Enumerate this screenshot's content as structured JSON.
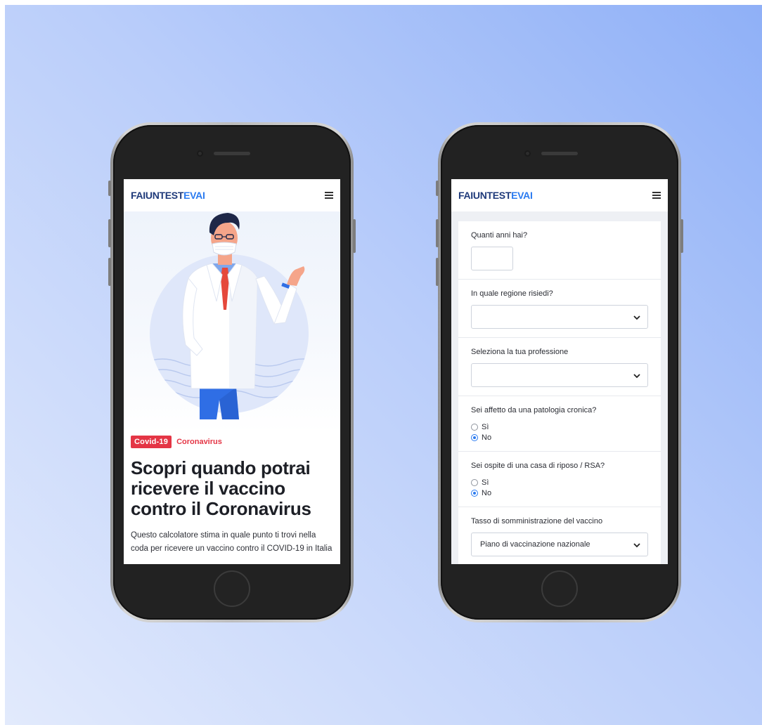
{
  "colors": {
    "background_start": "#e2eafc",
    "background_end": "#8fb0f7",
    "brand_dark": "#1f3a7a",
    "brand_blue": "#2b7bf0",
    "accent_red": "#e43545"
  },
  "logo": {
    "part_dark": "FAIUNTEST",
    "part_blue": "EVAI"
  },
  "left_screen": {
    "illustration": "doctor-with-mask-illustration",
    "tag": "Covid-19",
    "category": "Coronavirus",
    "headline": "Scopri quando potrai ricevere il vaccino contro il Coronavirus",
    "lead": "Questo calcolatore stima in quale punto ti trovi nella coda per ricevere un vaccino contro il COVID-19 in Italia"
  },
  "right_screen": {
    "questions": {
      "age": {
        "label": "Quanti anni hai?",
        "value": ""
      },
      "region": {
        "label": "In quale regione risiedi?",
        "value": ""
      },
      "profession": {
        "label": "Seleziona la tua professione",
        "value": ""
      },
      "chronic": {
        "label": "Sei affetto da una patologia cronica?",
        "options": [
          "Sì",
          "No"
        ],
        "selected": "No"
      },
      "rsa": {
        "label": "Sei ospite di una casa di riposo / RSA?",
        "options": [
          "Sì",
          "No"
        ],
        "selected": "No"
      },
      "rate": {
        "label": "Tasso di somministrazione del vaccino",
        "value": "Piano di vaccinazione nazionale"
      }
    }
  }
}
